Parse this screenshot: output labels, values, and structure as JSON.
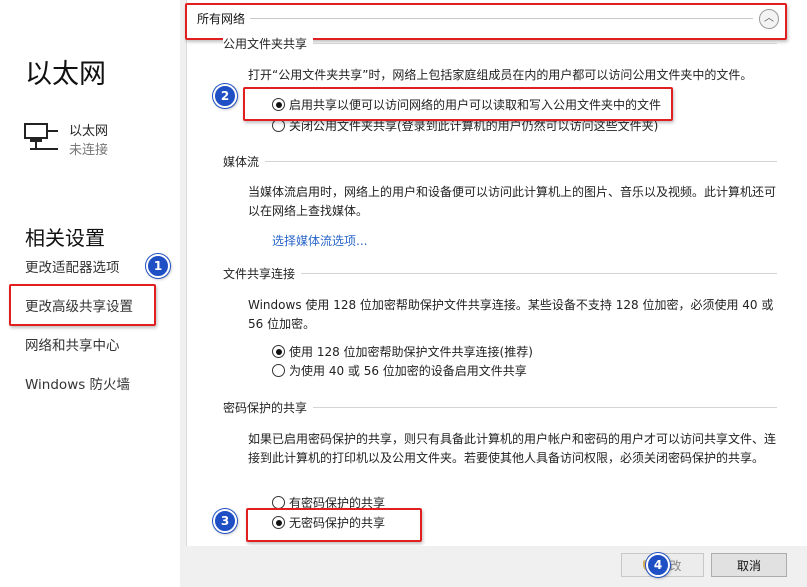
{
  "left": {
    "title": "以太网",
    "network": {
      "name": "以太网",
      "status": "未连接"
    },
    "related_heading": "相关设置",
    "links": [
      "更改适配器选项",
      "更改高级共享设置",
      "网络和共享中心",
      "Windows 防火墙"
    ]
  },
  "panel": {
    "group_header": "所有网络",
    "public_folder": {
      "title": "公用文件夹共享",
      "description": "打开“公用文件夹共享”时，网络上包括家庭组成员在内的用户都可以访问公用文件夹中的文件。",
      "options": [
        {
          "label": "启用共享以便可以访问网络的用户可以读取和写入公用文件夹中的文件",
          "checked": true
        },
        {
          "label": "关闭公用文件夹共享(登录到此计算机的用户仍然可以访问这些文件夹)",
          "checked": false
        }
      ]
    },
    "media": {
      "title": "媒体流",
      "description": "当媒体流启用时，网络上的用户和设备便可以访问此计算机上的图片、音乐以及视频。此计算机还可以在网络上查找媒体。",
      "link": "选择媒体流选项..."
    },
    "file_sharing": {
      "title": "文件共享连接",
      "description": "Windows 使用 128 位加密帮助保护文件共享连接。某些设备不支持 128 位加密，必须使用 40 或 56 位加密。",
      "options": [
        {
          "label": "使用 128 位加密帮助保护文件共享连接(推荐)",
          "checked": true
        },
        {
          "label": "为使用 40 或 56 位加密的设备启用文件共享",
          "checked": false
        }
      ]
    },
    "password": {
      "title": "密码保护的共享",
      "description": "如果已启用密码保护的共享，则只有具备此计算机的用户帐户和密码的用户才可以访问共享文件、连接到此计算机的打印机以及公用文件夹。若要使其他人具备访问权限，必须关闭密码保护的共享。",
      "options": [
        {
          "label": "有密码保护的共享",
          "checked": false
        },
        {
          "label": "无密码保护的共享",
          "checked": true
        }
      ]
    }
  },
  "buttons": {
    "save": "保存更改",
    "save_visible": "更改",
    "cancel": "取消"
  },
  "annotations": {
    "badges": [
      "1",
      "2",
      "3",
      "4"
    ],
    "highlight_color": "#e02020",
    "badge_color": "#1f4fc4"
  }
}
